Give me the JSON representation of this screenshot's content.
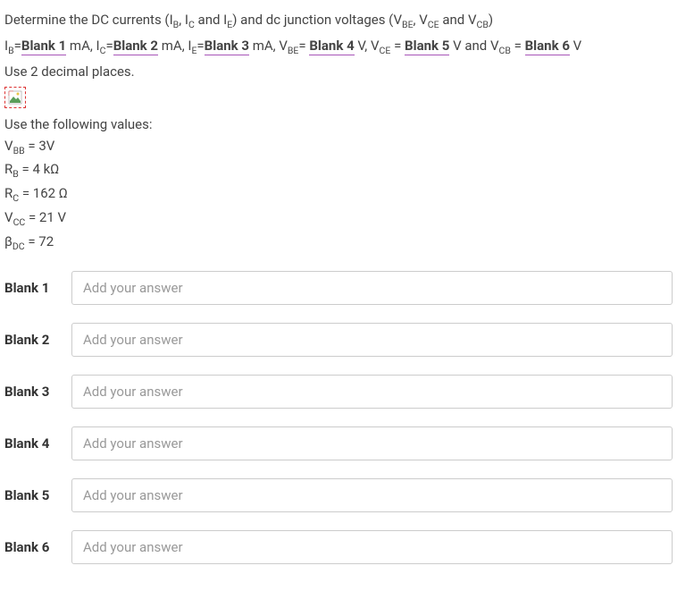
{
  "question": {
    "line1_pre": "Determine the DC currents (I",
    "line1_ib_sub": "B",
    "line1_mid1": ", I",
    "line1_ic_sub": "C",
    "line1_mid2": " and I",
    "line1_ie_sub": "E",
    "line1_mid3": ") and dc junction voltages (V",
    "line1_vbe_sub": "BE",
    "line1_mid4": ", V",
    "line1_vce_sub": "CE",
    "line1_mid5": " and V",
    "line1_vcb_sub": "CB",
    "line1_end": ")",
    "eq_ib": "I",
    "eq_ib_sub": "B",
    "eq_eq": "=",
    "blank1": "Blank 1",
    "unit_ma1": " mA, I",
    "eq_ic_sub": "C",
    "blank2": "Blank 2",
    "unit_ma2": " mA, I",
    "eq_ie_sub": "E",
    "blank3": "Blank 3",
    "unit_ma3": " mA, V",
    "eq_vbe_sub": "BE",
    "eq_space_eq": "= ",
    "blank4": "Blank 4",
    "unit_v1": " V, V",
    "eq_vce_sub": "CE",
    "eq_space_eq2": " = ",
    "blank5": "Blank 5",
    "unit_v2": " V and V",
    "eq_vcb_sub": "CB",
    "eq_space_eq3": " = ",
    "blank6": "Blank 6",
    "unit_v3": " V",
    "line3": "Use 2 decimal places.",
    "values_heading": "Use the following values:",
    "val1_pre": "V",
    "val1_sub": "BB",
    "val1_rest": " = 3V",
    "val2_pre": "R",
    "val2_sub": "B",
    "val2_rest": " = 4 kΩ",
    "val3_pre": "R",
    "val3_sub": "C",
    "val3_rest": " = 162 Ω",
    "val4_pre": "V",
    "val4_sub": "CC",
    "val4_rest": " = 21 V",
    "val5_pre": "β",
    "val5_sub": "DC",
    "val5_rest": " = 72"
  },
  "blanks": [
    {
      "label": "Blank 1",
      "placeholder": "Add your answer"
    },
    {
      "label": "Blank 2",
      "placeholder": "Add your answer"
    },
    {
      "label": "Blank 3",
      "placeholder": "Add your answer"
    },
    {
      "label": "Blank 4",
      "placeholder": "Add your answer"
    },
    {
      "label": "Blank 5",
      "placeholder": "Add your answer"
    },
    {
      "label": "Blank 6",
      "placeholder": "Add your answer"
    }
  ]
}
